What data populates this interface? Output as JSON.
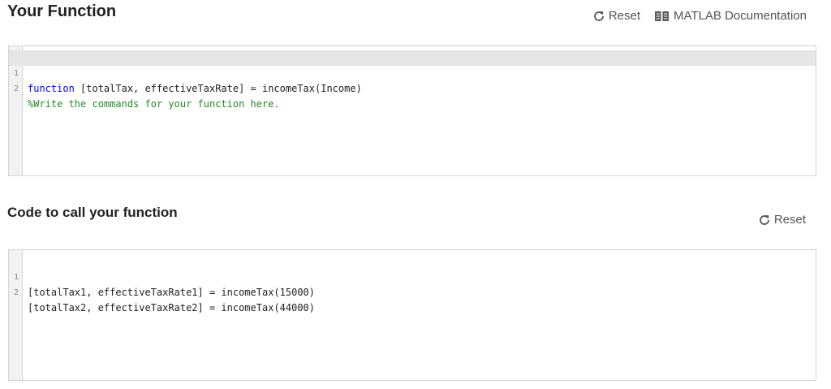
{
  "function_section": {
    "title": "Your Function",
    "reset_label": "Reset",
    "doc_label": "MATLAB Documentation",
    "lines": [
      {
        "number": "1",
        "keyword": "function",
        "text": " [totalTax, effectiveTaxRate] = incomeTax(Income)"
      },
      {
        "number": "2",
        "comment": "%Write the commands for your function here."
      }
    ]
  },
  "call_section": {
    "title": "Code to call your function",
    "reset_label": "Reset",
    "lines": [
      {
        "number": "1",
        "text": "[totalTax1, effectiveTaxRate1] = incomeTax(15000)"
      },
      {
        "number": "2",
        "text": "[totalTax2, effectiveTaxRate2] = incomeTax(44000)"
      }
    ]
  },
  "icons": {
    "reset": "reset-icon",
    "documentation": "book-icon"
  }
}
